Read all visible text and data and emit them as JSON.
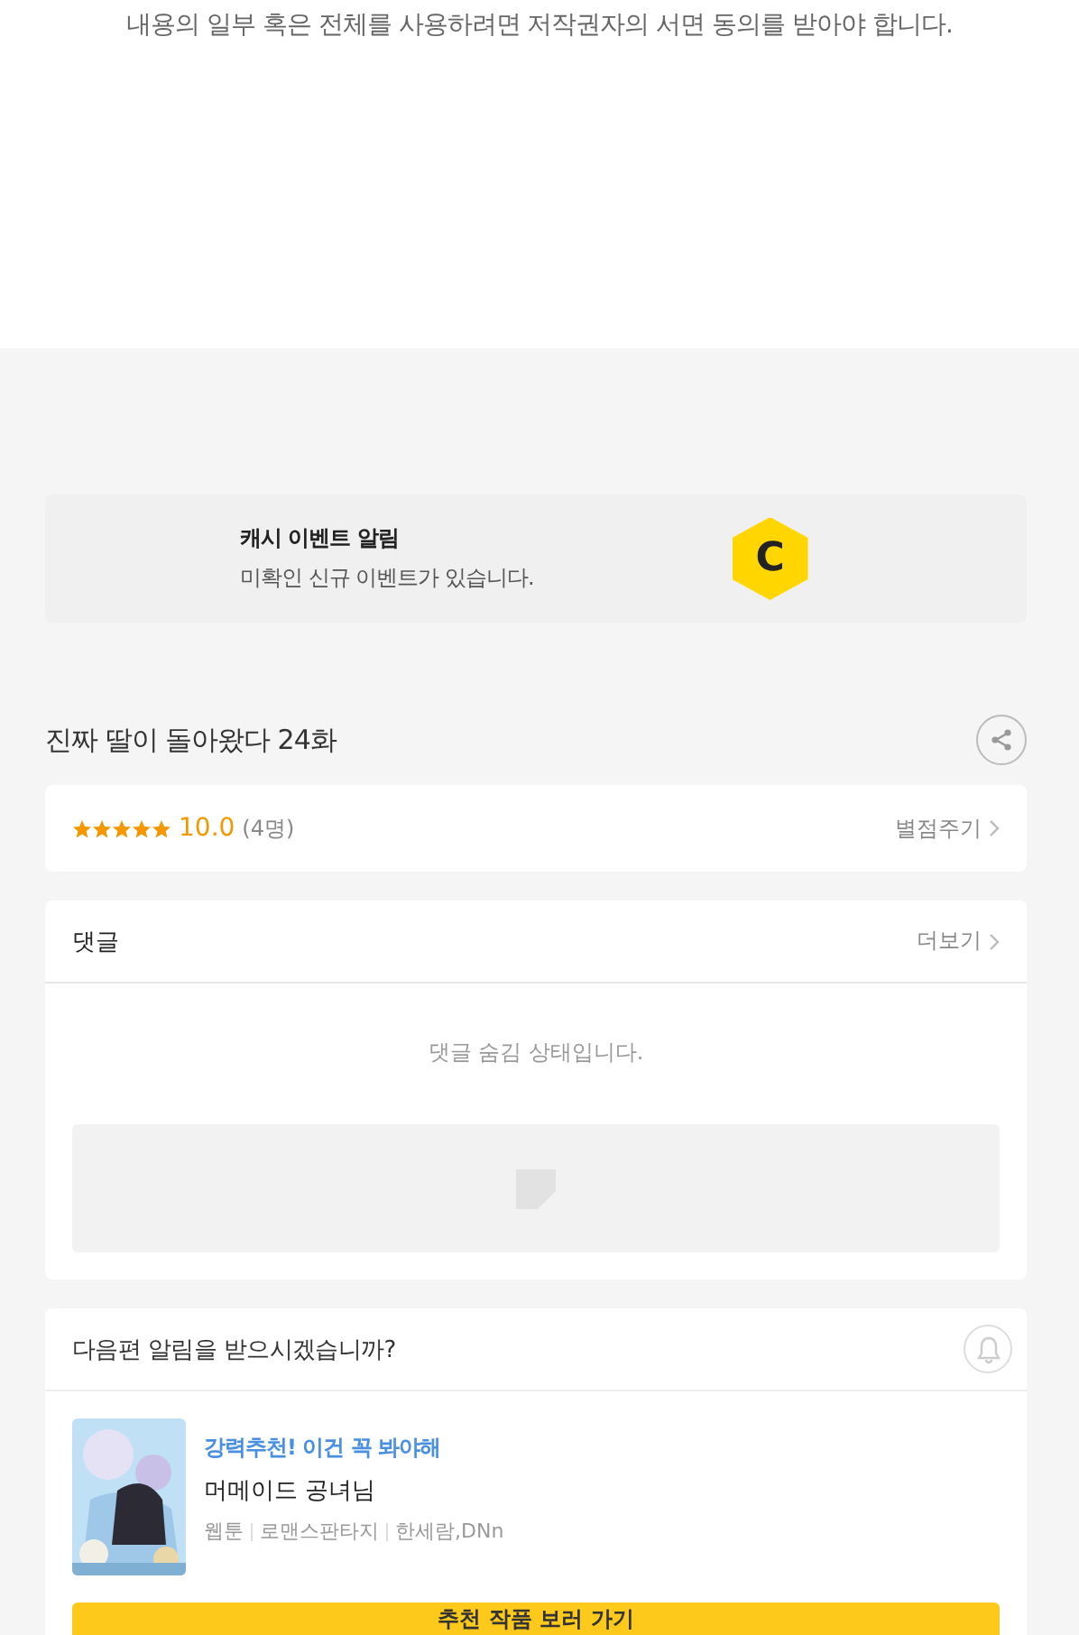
{
  "notice": {
    "text": "내용의 일부 혹은 전체를 사용하려면 저작권자의 서면 동의를 받아야 합니다."
  },
  "cash_event": {
    "title": "캐시 이벤트 알림",
    "subtitle": "미확인 신규 이벤트가 있습니다.",
    "badge": "C"
  },
  "episode": {
    "title": "진짜 딸이 돌아왔다 24화"
  },
  "rating": {
    "stars": 5,
    "score": "10.0",
    "count": "(4명)",
    "action": "별점주기"
  },
  "comments": {
    "title": "댓글",
    "more": "더보기",
    "message": "댓글 숨김 상태입니다."
  },
  "next_alert": {
    "question": "다음편 알림을 받으시겠습니까?",
    "recommendation": {
      "tagline": "강력추천! 이건 꼭 봐야해",
      "title": "머메이드 공녀님",
      "meta": [
        "웹툰",
        "로맨스판타지",
        "한세람,DNn"
      ]
    },
    "button": "추천 작품 보러 가기"
  }
}
